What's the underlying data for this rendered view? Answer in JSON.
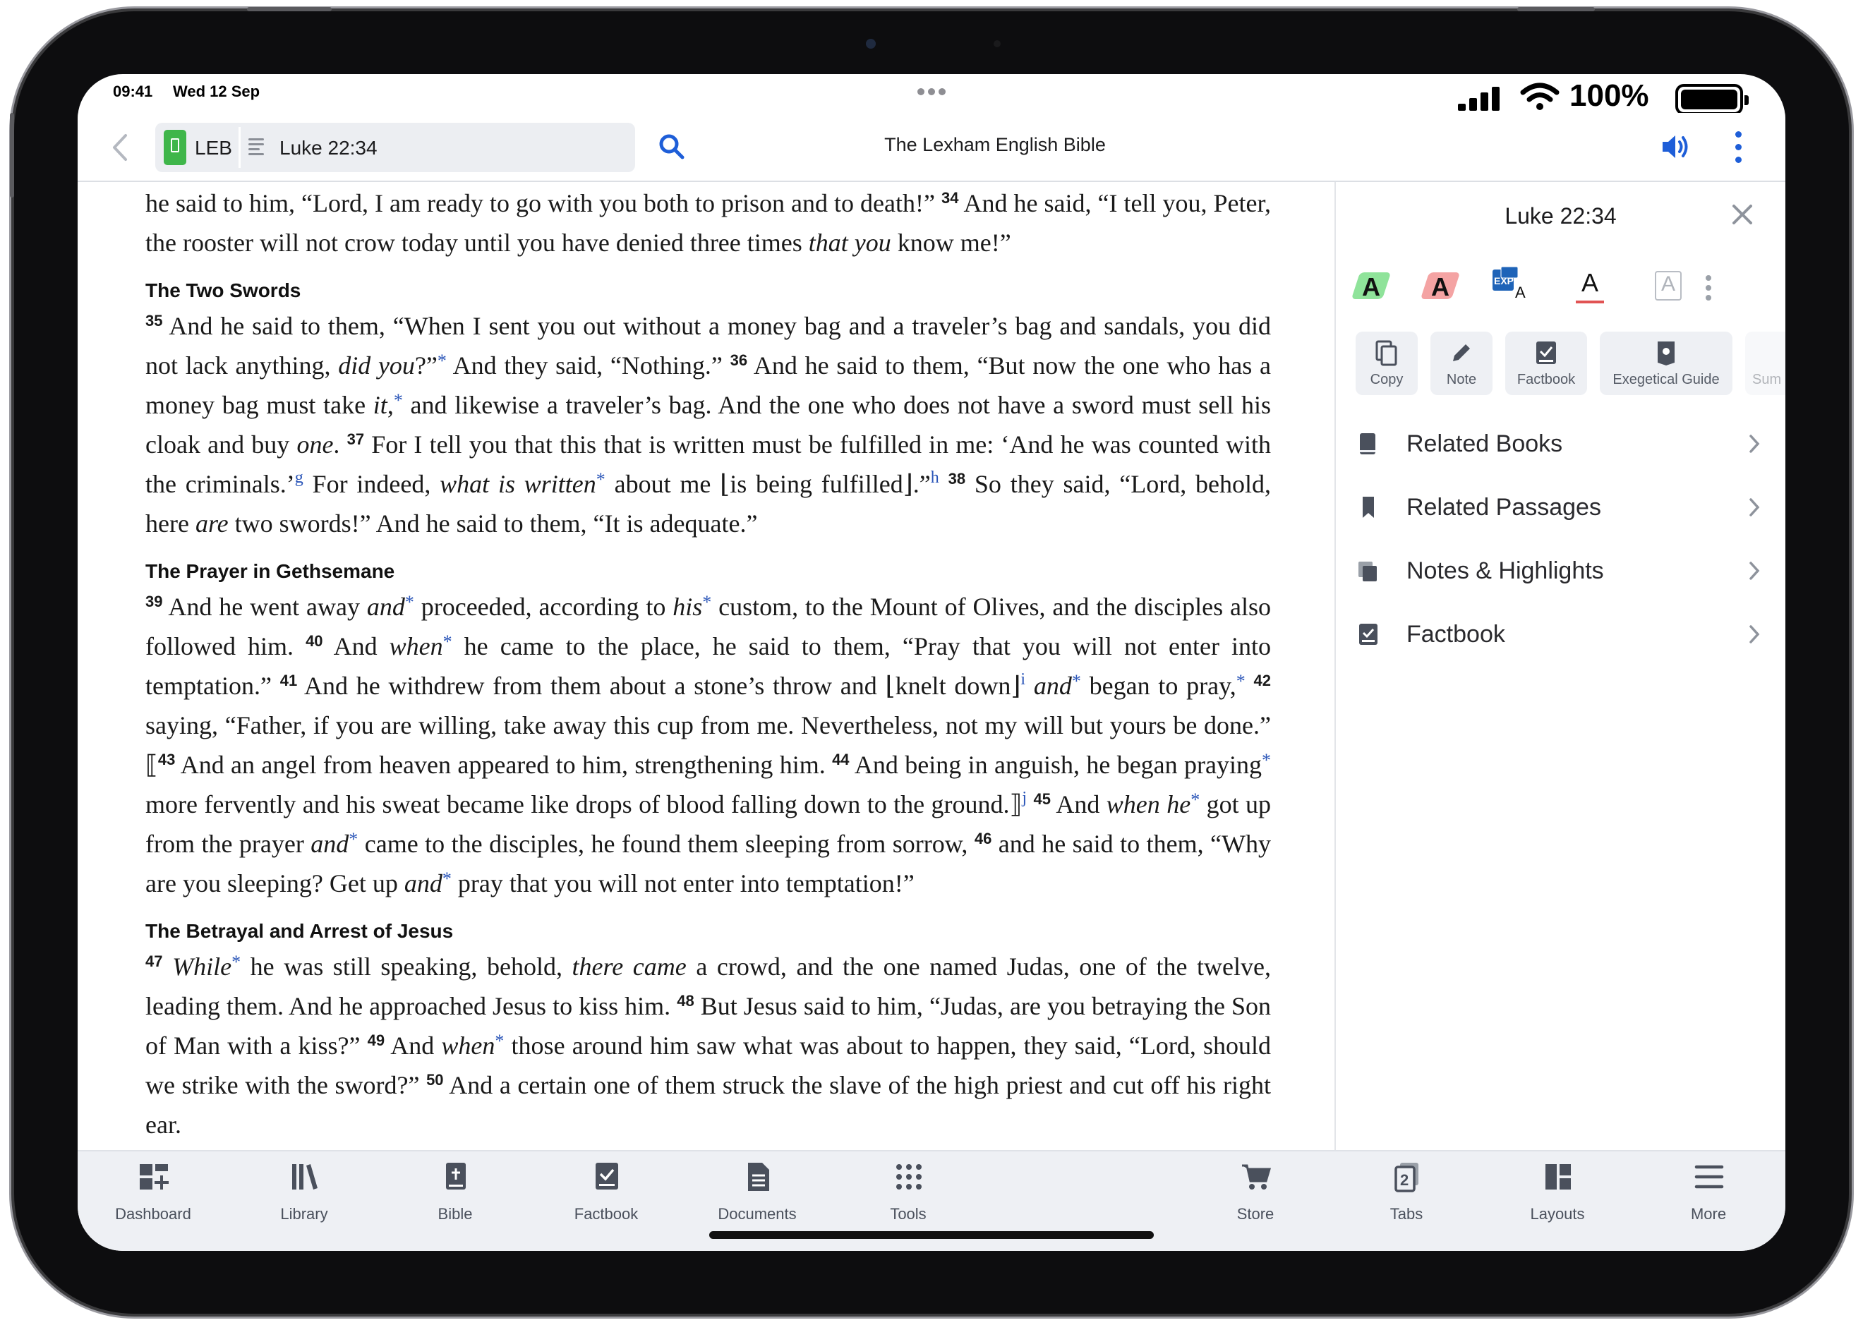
{
  "status": {
    "time": "09:41",
    "date": "Wed 12 Sep",
    "battery": "100%"
  },
  "toolbar": {
    "version": "LEB",
    "reference": "Luke 22:34",
    "book_title": "The Lexham English Bible"
  },
  "reader": {
    "p1": [
      {
        "t": "he said to him, “Lord, I am ready to go with you both to prison and to death!” "
      },
      {
        "v": "34"
      },
      {
        "t": " And he said, “I tell you, Peter, the rooster will not crow today until you have denied three times "
      },
      {
        "i": "that you"
      },
      {
        "t": " know me!”"
      }
    ],
    "h1": "The Two Swords",
    "p2": [
      {
        "v": "35"
      },
      {
        "t": " And he said to them, “When I sent you out without a money bag and a traveler’s bag and sandals, you did not lack anything, "
      },
      {
        "i": "did you"
      },
      {
        "t": "?”"
      },
      {
        "f": "*"
      },
      {
        "t": " And they said, “Nothing.” "
      },
      {
        "v": "36"
      },
      {
        "t": " And he said to them, “But now the one who has a money bag must take "
      },
      {
        "i": "it"
      },
      {
        "t": ","
      },
      {
        "f": "*"
      },
      {
        "t": " and likewise a traveler’s bag. And the one who does not have a sword must sell his cloak and buy "
      },
      {
        "i": "one"
      },
      {
        "t": ". "
      },
      {
        "v": "37"
      },
      {
        "t": " For I tell you that this that is written must be fulfilled in me: ‘And he was counted with the criminals.’"
      },
      {
        "a": "g"
      },
      {
        "t": " For indeed, "
      },
      {
        "i": "what is written"
      },
      {
        "f": "*"
      },
      {
        "t": " about me ⌊is being fulfilled⌋.”"
      },
      {
        "a": "h"
      },
      {
        "t": " "
      },
      {
        "v": "38"
      },
      {
        "t": " So they said, “Lord, behold, here "
      },
      {
        "i": "are"
      },
      {
        "t": " two swords!” And he said to them, “It is adequate.”"
      }
    ],
    "h2": "The Prayer in Gethsemane",
    "p3": [
      {
        "v": "39"
      },
      {
        "t": " And he went away "
      },
      {
        "i": "and"
      },
      {
        "f": "*"
      },
      {
        "t": " proceeded, according to "
      },
      {
        "i": "his"
      },
      {
        "f": "*"
      },
      {
        "t": " custom, to the Mount of Olives, and the disciples also followed him. "
      },
      {
        "v": "40"
      },
      {
        "t": " And "
      },
      {
        "i": "when"
      },
      {
        "f": "*"
      },
      {
        "t": " he came to the place, he said to them, “Pray that you will not enter into temptation.” "
      },
      {
        "v": "41"
      },
      {
        "t": " And he withdrew from them about a stone’s throw and ⌊knelt down⌋"
      },
      {
        "a": "i"
      },
      {
        "t": " "
      },
      {
        "i": "and"
      },
      {
        "f": "*"
      },
      {
        "t": " began to pray,"
      },
      {
        "f": "*"
      },
      {
        "t": " "
      },
      {
        "v": "42"
      },
      {
        "t": " saying, “Father, if you are willing, take away this cup from me. Nevertheless, not my will but yours be done.” ⟦"
      },
      {
        "v": "43"
      },
      {
        "t": " And an angel from heaven appeared to him, strengthening him. "
      },
      {
        "v": "44"
      },
      {
        "t": " And being in anguish, he began praying"
      },
      {
        "f": "*"
      },
      {
        "t": " more fervently and his sweat became like drops of blood falling down to the ground.⟧"
      },
      {
        "a": "j"
      },
      {
        "t": " "
      },
      {
        "v": "45"
      },
      {
        "t": " And "
      },
      {
        "i": "when he"
      },
      {
        "f": "*"
      },
      {
        "t": " got up from the prayer "
      },
      {
        "i": "and"
      },
      {
        "f": "*"
      },
      {
        "t": " came to the disciples, he found them sleeping from sorrow, "
      },
      {
        "v": "46"
      },
      {
        "t": " and he said to them, “Why are you sleeping? Get up "
      },
      {
        "i": "and"
      },
      {
        "f": "*"
      },
      {
        "t": " pray that you will not enter into temptation!”"
      }
    ],
    "h3": "The Betrayal and Arrest of Jesus",
    "p4": [
      {
        "v": "47"
      },
      {
        "t": " "
      },
      {
        "i": "While"
      },
      {
        "f": "*"
      },
      {
        "t": " he was still speaking, behold, "
      },
      {
        "i": "there came"
      },
      {
        "t": " a crowd, and the one named Judas, one of the twelve, leading them. And he approached Jesus to kiss him. "
      },
      {
        "v": "48"
      },
      {
        "t": " But Jesus said to him, “Judas, are you betraying the Son of Man with a kiss?” "
      },
      {
        "v": "49"
      },
      {
        "t": " And "
      },
      {
        "i": "when"
      },
      {
        "f": "*"
      },
      {
        "t": " those around him saw what was about to happen, they said, “Lord, should we strike with the sword?” "
      },
      {
        "v": "50"
      },
      {
        "t": " And a certain one of them struck the slave of the high priest and cut off his right ear."
      }
    ]
  },
  "panel": {
    "title": "Luke 22:34",
    "highlight_colors": {
      "green": "#8fe39a",
      "red": "#f4a3a3",
      "underline": "#e15353",
      "blue": "#1e63b8"
    },
    "highlight_letters": [
      "A",
      "A",
      "A",
      "A",
      "A"
    ],
    "exp_label": "EXP",
    "actions": [
      "Copy",
      "Note",
      "Factbook",
      "Exegetical Guide",
      "Sum"
    ],
    "items": [
      "Related Books",
      "Related Passages",
      "Notes & Highlights",
      "Factbook"
    ]
  },
  "tabs": [
    "Dashboard",
    "Library",
    "Bible",
    "Factbook",
    "Documents",
    "Tools",
    "Store",
    "Tabs",
    "Layouts",
    "More"
  ],
  "tabs_count": "2",
  "accent": "#1e5ed8"
}
